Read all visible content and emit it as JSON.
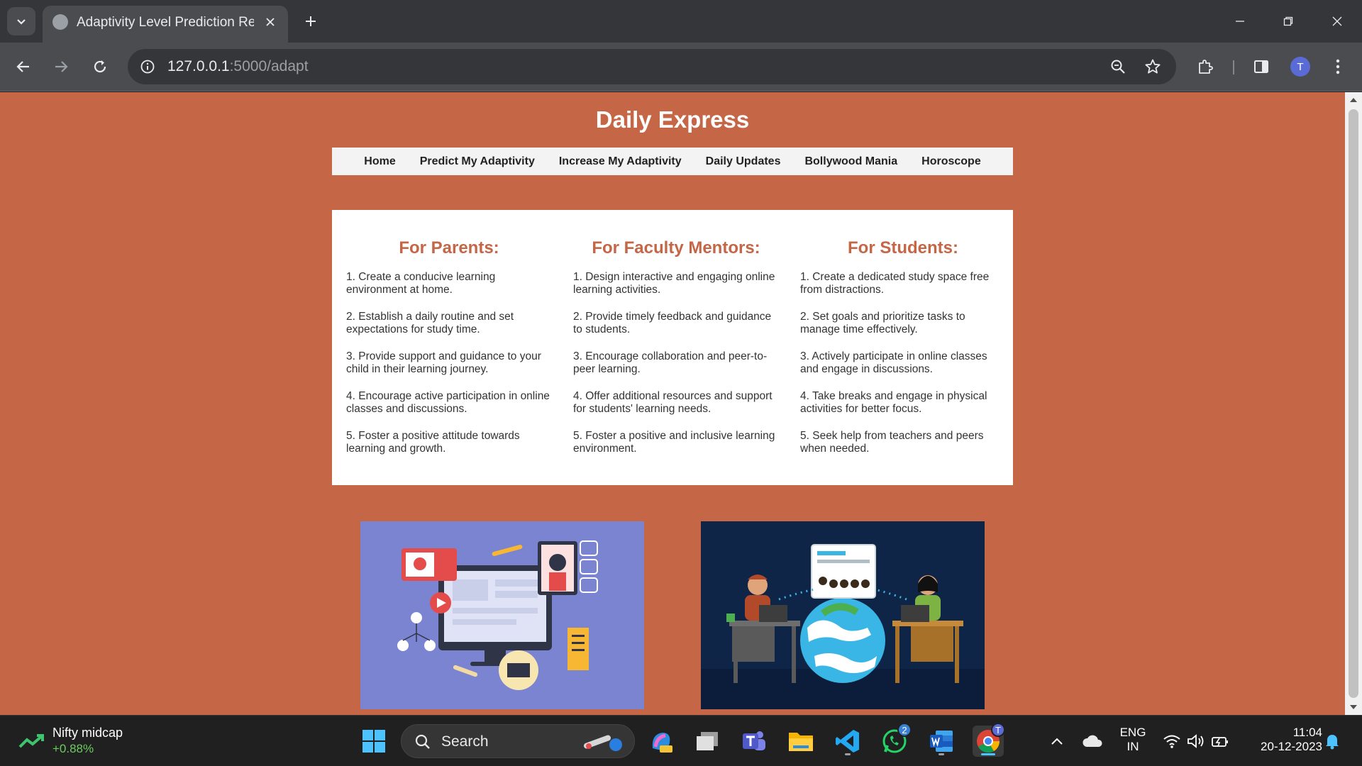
{
  "browser": {
    "tab_title": "Adaptivity Level Prediction Resu",
    "url_host": "127.0.0.1",
    "url_path": ":5000/adapt",
    "profile_initial": "T"
  },
  "site": {
    "title": "Daily Express",
    "nav": [
      "Home",
      "Predict My Adaptivity",
      "Increase My Adaptivity",
      "Daily Updates",
      "Bollywood Mania",
      "Horoscope"
    ]
  },
  "tips": {
    "parents": {
      "heading": "For Parents:",
      "items": [
        "1. Create a conducive learning environment at home.",
        "2. Establish a daily routine and set expectations for study time.",
        "3. Provide support and guidance to your child in their learning journey.",
        "4. Encourage active participation in online classes and discussions.",
        "5. Foster a positive attitude towards learning and growth."
      ]
    },
    "mentors": {
      "heading": "For Faculty Mentors:",
      "items": [
        "1. Design interactive and engaging online learning activities.",
        "2. Provide timely feedback and guidance to students.",
        "3. Encourage collaboration and peer-to-peer learning.",
        "4. Offer additional resources and support for students' learning needs.",
        "5. Foster a positive and inclusive learning environment."
      ]
    },
    "students": {
      "heading": "For Students:",
      "items": [
        "1. Create a dedicated study space free from distractions.",
        "2. Set goals and prioritize tasks to manage time effectively.",
        "3. Actively participate in online classes and engage in discussions.",
        "4. Take breaks and engage in physical activities for better focus.",
        "5. Seek help from teachers and peers when needed."
      ]
    }
  },
  "colors": {
    "page_bg": "#c56646",
    "heading_accent": "#c56646",
    "nav_bg": "#f3f3f3",
    "card_bg": "#ffffff",
    "illus1_bg": "#7b84d1",
    "illus2_bg": "#0f2548"
  },
  "icons": {
    "tab_list": "chevron-down-icon",
    "close": "close-icon",
    "new_tab": "plus-icon",
    "back": "arrow-left-icon",
    "forward": "arrow-right-icon",
    "reload": "reload-icon",
    "site_info": "info-icon",
    "zoom": "zoom-out-icon",
    "bookmark": "star-icon",
    "extensions": "puzzle-icon",
    "side_panel": "side-panel-icon",
    "menu": "kebab-menu-icon"
  },
  "taskbar": {
    "widget_name": "Nifty midcap",
    "widget_value": "+0.88%",
    "search_label": "Search",
    "whatsapp_badge": "2",
    "chrome_badge": "T",
    "lang_top": "ENG",
    "lang_bottom": "IN",
    "time": "11:04",
    "date": "20-12-2023"
  }
}
